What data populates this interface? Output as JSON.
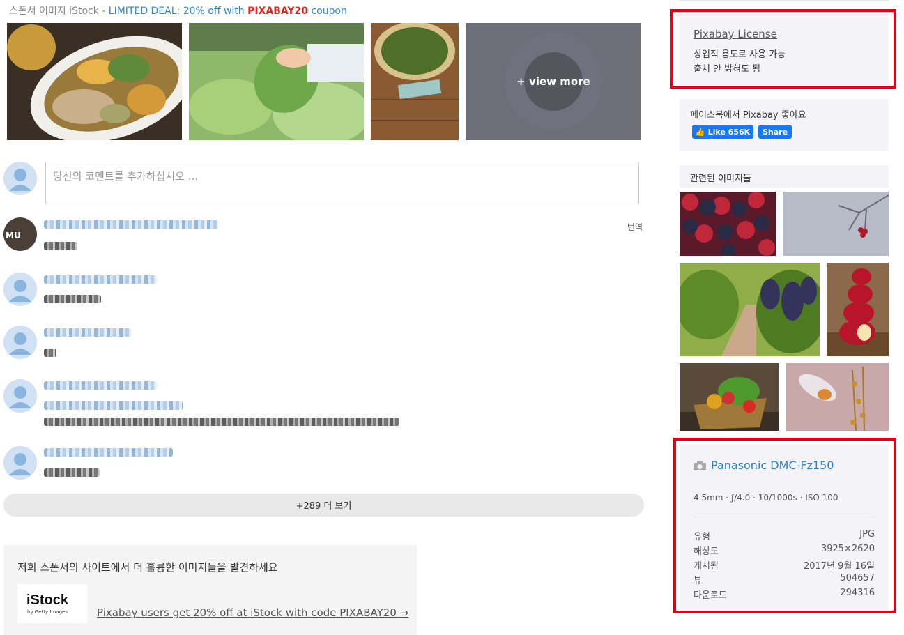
{
  "sponsor": {
    "prefix": "스폰서 이미지 iStock - ",
    "deal_text": "LIMITED DEAL: 20% off with ",
    "code": "PIXABAY20",
    "suffix": " coupon",
    "view_more": "+ view more"
  },
  "comments": {
    "placeholder": "당신의 코멘트를 추가하십시오 ...",
    "translate": "번역",
    "avatar_text": "MU",
    "load_more": "+289 더 보기"
  },
  "promo": {
    "heading": "저희 스폰서의 사이트에서 더 훌륭한 이미지들을 발견하세요",
    "logo_main": "iStock",
    "logo_sub": "by Getty Images",
    "link": "Pixabay users get 20% off at iStock with code PIXABAY20 →"
  },
  "license": {
    "title": "Pixabay License",
    "line1": "상업적 용도로 사용 가능",
    "line2": "출처 안 밝혀도 됨"
  },
  "facebook": {
    "text": "페이스북에서 Pixabay 좋아요",
    "like": "Like 656K",
    "share": "Share"
  },
  "related": {
    "title": "관련된 이미지들"
  },
  "info": {
    "camera": "Panasonic DMC-Fz150",
    "exposure": "4.5mm · ƒ/4.0 · 10/1000s · ISO 100",
    "rows": [
      {
        "key": "유형",
        "value": "JPG"
      },
      {
        "key": "해상도",
        "value": "3925×2620"
      },
      {
        "key": "게시됨",
        "value": "2017년 9월 16일"
      },
      {
        "key": "뷰",
        "value": "504657"
      },
      {
        "key": "다운로드",
        "value": "294316"
      }
    ]
  }
}
